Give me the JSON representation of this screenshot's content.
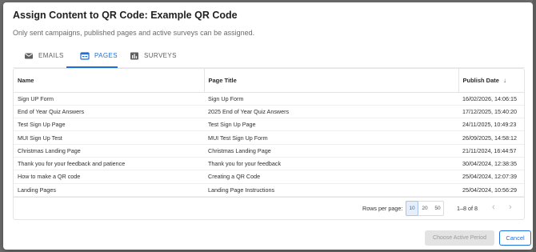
{
  "dialog": {
    "title": "Assign Content to QR Code: Example QR Code",
    "subtitle": "Only sent campaigns, published pages and active surveys can be assigned."
  },
  "tabs": [
    {
      "label": "EMAILS",
      "icon": "email-icon",
      "active": false
    },
    {
      "label": "PAGES",
      "icon": "page-icon",
      "active": true
    },
    {
      "label": "SURVEYS",
      "icon": "bar-chart-icon",
      "active": false
    }
  ],
  "table": {
    "headers": [
      "Name",
      "Page Title",
      "Publish Date"
    ],
    "sort_icon": "arrow-down-icon",
    "rows": [
      [
        "Sign UP Form",
        "Sign Up Form",
        "16/02/2026, 14:06:15"
      ],
      [
        "End of Year Quiz Answers",
        "2025 End of Year Quiz Answers",
        "17/12/2025, 15:40:20"
      ],
      [
        "Test Sign Up Page",
        "Test Sign Up Page",
        "24/11/2025, 10:49:23"
      ],
      [
        "MUI Sign Up Test",
        "MUI Test Sign Up Form",
        "26/09/2025, 14:58:12"
      ],
      [
        "Christmas Landing Page",
        "Christmas Landing Page",
        "21/11/2024, 16:44:57"
      ],
      [
        "Thank you for your feedback and patience",
        "Thank you for your feedback",
        "30/04/2024, 12:38:35"
      ],
      [
        "How to make a QR code",
        "Creating a QR Code",
        "25/04/2024, 12:07:39"
      ],
      [
        "Landing Pages",
        "Landing Page Instructions",
        "25/04/2024, 10:56:29"
      ]
    ]
  },
  "pagination": {
    "rows_per_page_label": "Rows per page:",
    "options": [
      "10",
      "20",
      "50"
    ],
    "selected": "10",
    "range": "1–8 of 8"
  },
  "actions": {
    "choose_label": "Choose Active Period",
    "cancel_label": "Cancel"
  },
  "colors": {
    "accent": "#1e6fd9",
    "overlay": "#6e6e6e"
  }
}
